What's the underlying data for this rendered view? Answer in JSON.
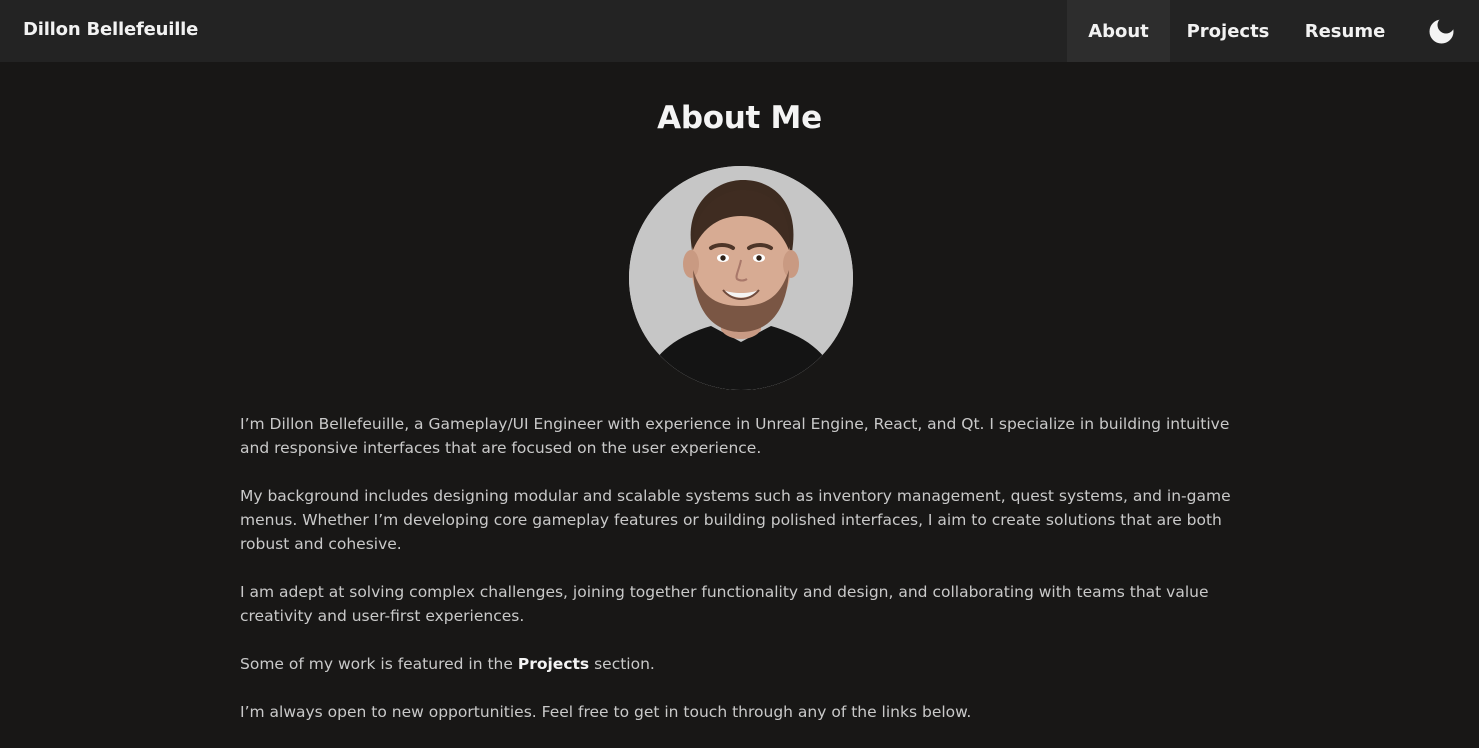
{
  "navbar": {
    "brand": "Dillon Bellefeuille",
    "links": [
      {
        "label": "About",
        "active": true
      },
      {
        "label": "Projects",
        "active": false
      },
      {
        "label": "Resume",
        "active": false
      }
    ],
    "theme_icon": "moon-icon"
  },
  "main": {
    "title": "About Me",
    "avatar_icon": "profile-photo",
    "paragraphs": [
      {
        "text": "I’m Dillon Bellefeuille, a Gameplay/UI Engineer with experience in Unreal Engine, React, and Qt. I specialize in building intuitive and responsive interfaces that are focused on the user experience."
      },
      {
        "text": "My background includes designing modular and scalable systems such as inventory management, quest systems, and in-game menus. Whether I’m developing core gameplay features or building polished interfaces, I aim to create solutions that are both robust and cohesive."
      },
      {
        "text": "I am adept at solving complex challenges, joining together functionality and design, and collaborating with teams that value creativity and user-first experiences."
      },
      {
        "before": "Some of my work is featured in the ",
        "link": "Projects",
        "after": " section."
      },
      {
        "text": "I’m always open to new opportunities. Feel free to get in touch through any of the links below."
      }
    ]
  },
  "colors": {
    "background": "#181716",
    "navbar": "#232323",
    "nav_active": "#2d2d2d",
    "text": "#c9c9c9",
    "heading": "#f4f4f4",
    "avatar_bg": "#c8c8c8"
  }
}
